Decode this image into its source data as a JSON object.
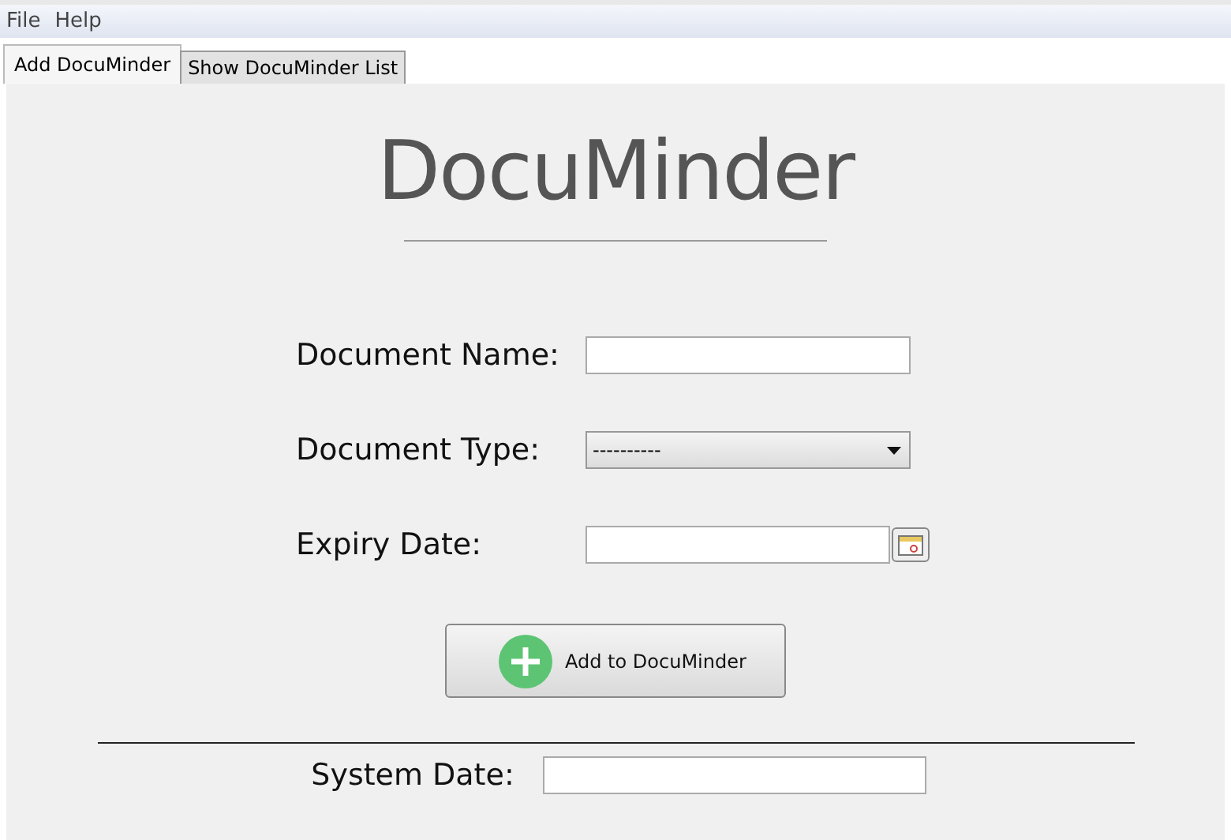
{
  "menu": [
    "File",
    "Help"
  ],
  "tabs": [
    {
      "label": "Add DocuMinder",
      "selected": true
    },
    {
      "label": "Show DocuMinder List",
      "selected": false
    }
  ],
  "logo": "DocuMinder",
  "form": [
    {
      "kind": "text",
      "label": "Document Name:"
    },
    {
      "kind": "select",
      "label": "Document Type:",
      "value": "----------"
    },
    {
      "kind": "date",
      "label": "Expiry Date:"
    }
  ],
  "add_button": "Add to DocuMinder",
  "system_date": {
    "label": "System Date:"
  }
}
